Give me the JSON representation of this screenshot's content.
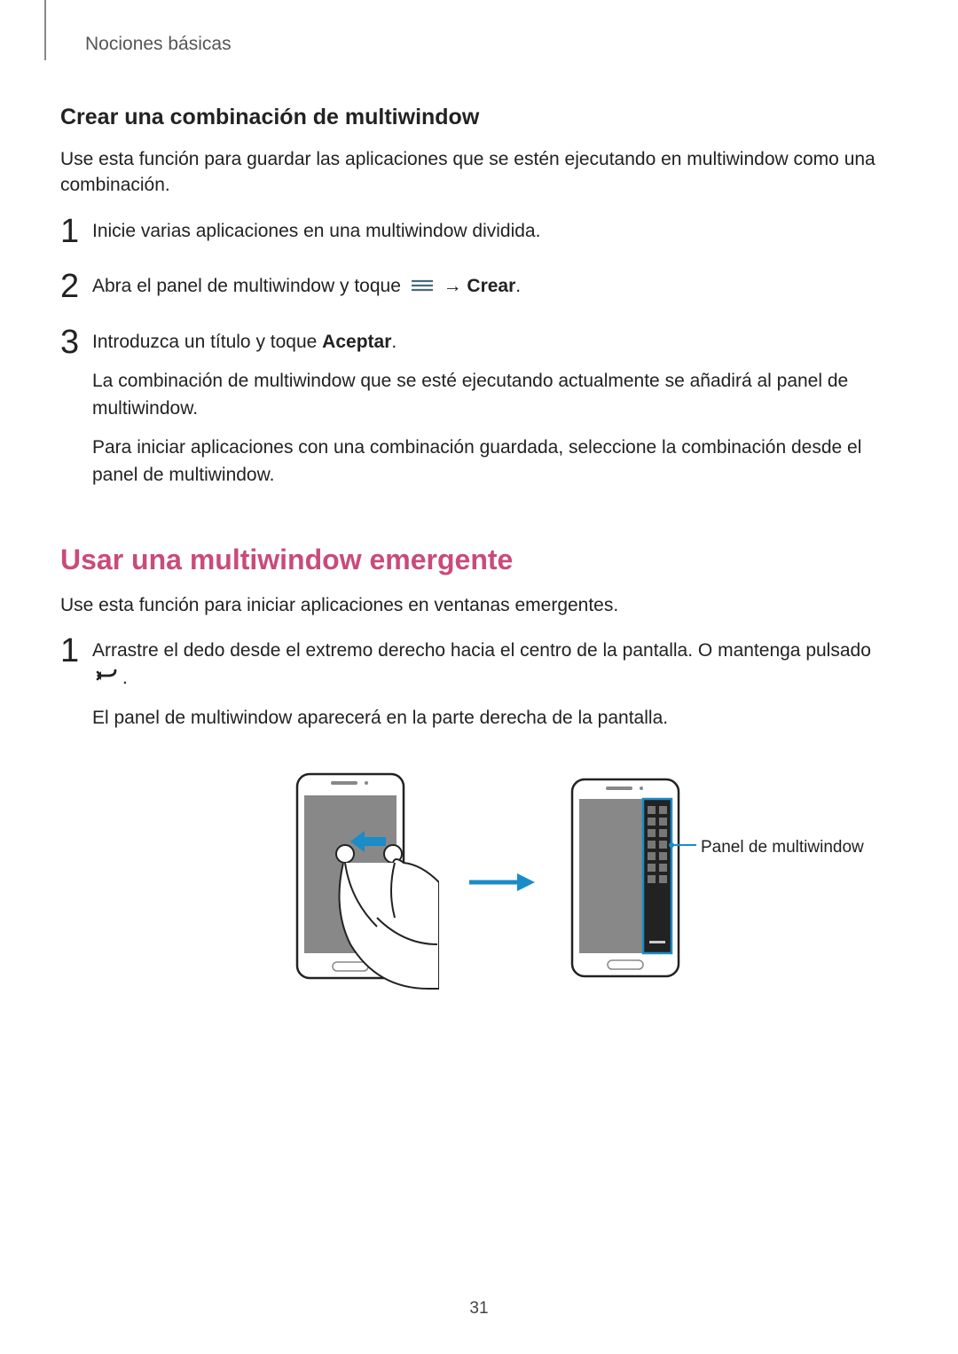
{
  "breadcrumb": "Nociones básicas",
  "section1": {
    "heading": "Crear una combinación de multiwindow",
    "intro": "Use esta función para guardar las aplicaciones que se estén ejecutando en multiwindow como una combinación.",
    "steps": [
      {
        "num": "1",
        "text": "Inicie varias aplicaciones en una multiwindow dividida."
      },
      {
        "num": "2",
        "prefix": "Abra el panel de multiwindow y toque ",
        "arrow": " → ",
        "bold": "Crear",
        "suffix": "."
      },
      {
        "num": "3",
        "line1_prefix": "Introduzca un título y toque ",
        "line1_bold": "Aceptar",
        "line1_suffix": ".",
        "para2": "La combinación de multiwindow que se esté ejecutando actualmente se añadirá al panel de multiwindow.",
        "para3": "Para iniciar aplicaciones con una combinación guardada, seleccione la combinación desde el panel de multiwindow."
      }
    ]
  },
  "section2": {
    "heading": "Usar una multiwindow emergente",
    "intro": "Use esta función para iniciar aplicaciones en ventanas emergentes.",
    "steps": [
      {
        "num": "1",
        "line1": "Arrastre el dedo desde el extremo derecho hacia el centro de la pantalla. O mantenga pulsado ",
        "line1_suffix": ".",
        "para2": "El panel de multiwindow aparecerá en la parte derecha de la pantalla."
      }
    ],
    "callout": "Panel de multiwindow"
  },
  "page_number": "31"
}
